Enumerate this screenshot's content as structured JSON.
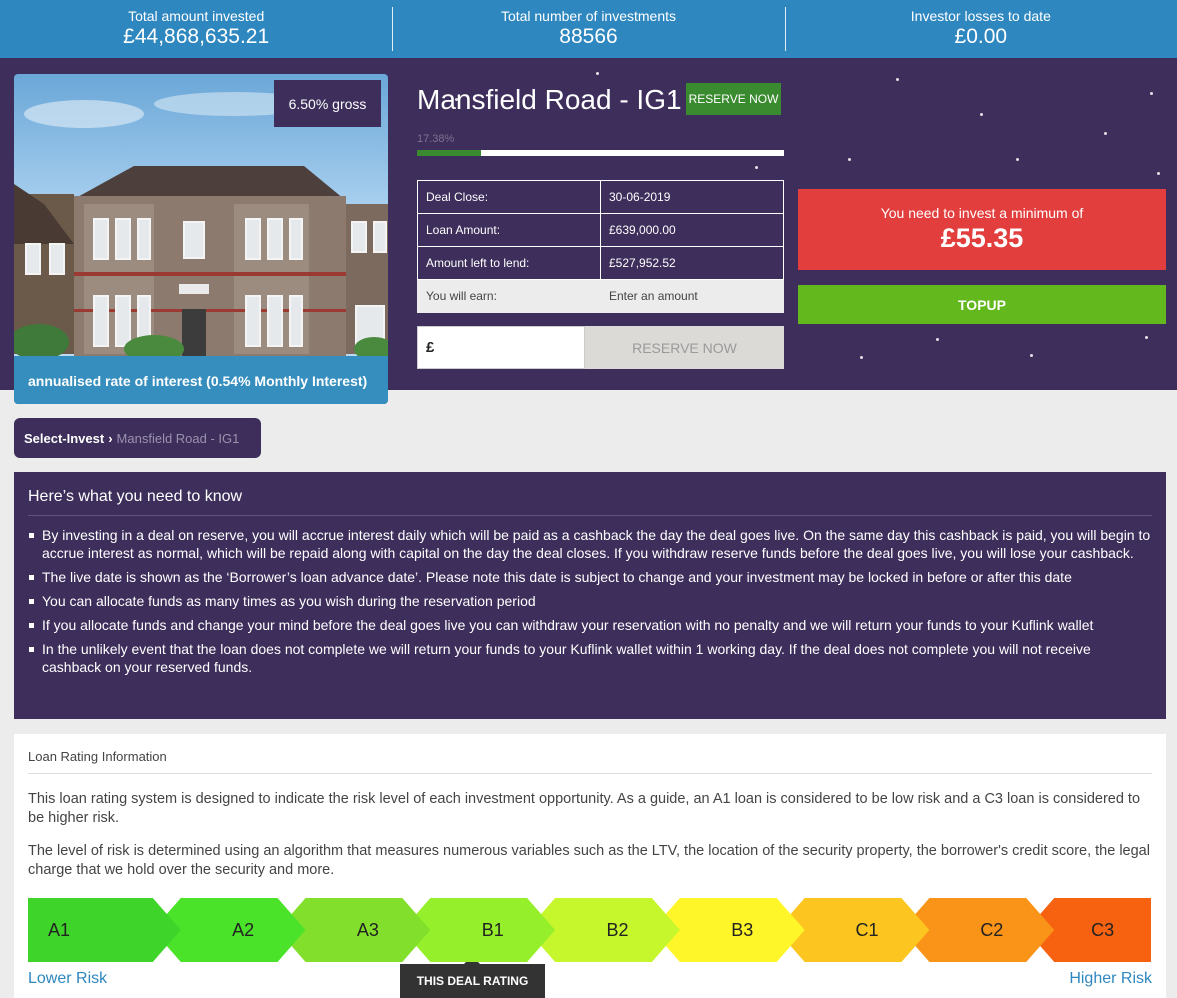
{
  "stats": [
    {
      "label": "Total amount invested",
      "value": "£44,868,635.21"
    },
    {
      "label": "Total number of investments",
      "value": "88566"
    },
    {
      "label": "Investor losses to date",
      "value": "£0.00"
    }
  ],
  "deal": {
    "gross_rate": "6.50% gross",
    "photo_caption": "annualised rate of interest (0.54% Monthly Interest)",
    "title": "Mansfield Road - IG1",
    "reserve_label": "RESERVE NOW",
    "progress_label": "17.38%",
    "progress_fraction": 0.1738,
    "table": [
      {
        "label": "Deal Close:",
        "value": "30-06-2019"
      },
      {
        "label": "Loan Amount:",
        "value": "£639,000.00"
      },
      {
        "label": "Amount left to lend:",
        "value": "£527,952.52"
      },
      {
        "label": "You will earn:",
        "value": "Enter an amount"
      }
    ],
    "currency_symbol": "£",
    "reserve_button": "RESERVE NOW",
    "minimum_label": "You need to invest a minimum of",
    "minimum_value": "£55.35",
    "topup_label": "TOPUP"
  },
  "breadcrumb": {
    "home": "Select-Invest",
    "separator": "›",
    "current": "Mansfield Road - IG1"
  },
  "info": {
    "title": "Here’s what you need to know",
    "items": [
      "By investing in a deal on reserve, you will accrue interest daily which will be paid as a cashback the day the deal goes live. On the same day this cashback is paid, you will begin to accrue interest as normal, which will be repaid along with capital on the day the deal closes. If you withdraw reserve funds before the deal goes live, you will lose your cashback.",
      "The live date is shown as the ‘Borrower’s loan advance date’. Please note this date is subject to change and your investment may be locked in before or after this date",
      "You can allocate funds as many times as you wish during the reservation period",
      "If you allocate funds and change your mind before the deal goes live you can withdraw your reservation with no penalty and we will return your funds to your Kuflink wallet",
      "In the unlikely event that the loan does not complete we will return your funds to your Kuflink wallet within 1 working day. If the deal does not complete you will not receive cashback on your reserved funds."
    ]
  },
  "rating": {
    "title": "Loan Rating Information",
    "paragraph1": "This loan rating system is designed to indicate the risk level of each investment opportunity. As a guide, an A1 loan is considered to be low risk and a C3 loan is considered to be higher risk.",
    "paragraph2": "The level of risk is determined using an algorithm that measures numerous variables such as the LTV, the location of the security property, the borrower's credit score, the legal charge that we hold over the security and more.",
    "grades": [
      "A1",
      "A2",
      "A3",
      "B1",
      "B2",
      "B3",
      "C1",
      "C2",
      "C3"
    ],
    "grade_colors": [
      "#3ed42a",
      "#4be32a",
      "#82e02c",
      "#95f02b",
      "#c6f62c",
      "#fff62a",
      "#fcc51f",
      "#f99418",
      "#f6620f"
    ],
    "current_grade": "B1",
    "deal_rating_label": "THIS DEAL RATING",
    "lower_risk": "Lower Risk",
    "higher_risk": "Higher Risk"
  }
}
